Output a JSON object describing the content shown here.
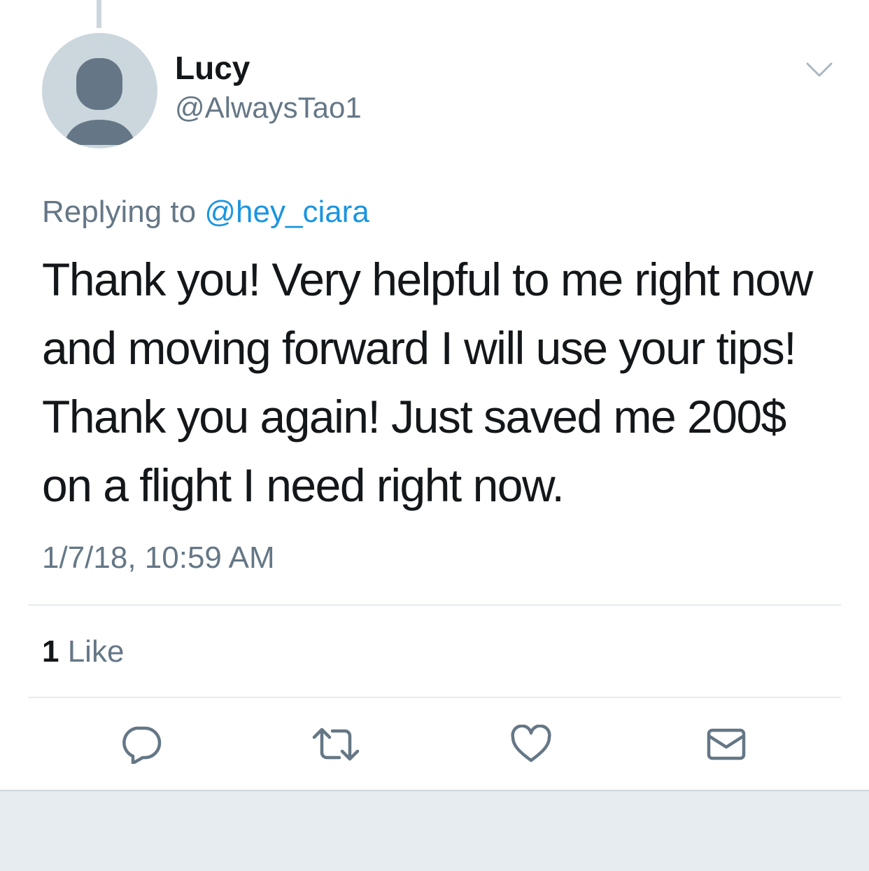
{
  "tweet": {
    "author": {
      "display_name": "Lucy",
      "handle": "@AlwaysTao1",
      "avatar_icon": "default-profile-silhouette-icon"
    },
    "reply": {
      "prefix": "Replying to ",
      "mention": "@hey_ciara"
    },
    "text": "Thank you!  Very helpful to me right now\nand moving forward I will use your tips!\nThank you again!  Just saved me 200$\non a flight I need right now.",
    "timestamp": "1/7/18, 10:59 AM",
    "stats": {
      "like_count": "1",
      "like_label": " Like"
    }
  },
  "actions": [
    {
      "name": "reply",
      "icon": "reply-icon"
    },
    {
      "name": "retweet",
      "icon": "retweet-icon"
    },
    {
      "name": "like",
      "icon": "heart-icon"
    },
    {
      "name": "direct-message",
      "icon": "envelope-icon"
    }
  ],
  "colors": {
    "text_primary": "#14171a",
    "text_secondary": "#657786",
    "link": "#1b95e0",
    "divider": "#e6ecf0",
    "icon": "#657786",
    "avatar_bg": "#ccd6dd",
    "avatar_fg": "#657786"
  }
}
